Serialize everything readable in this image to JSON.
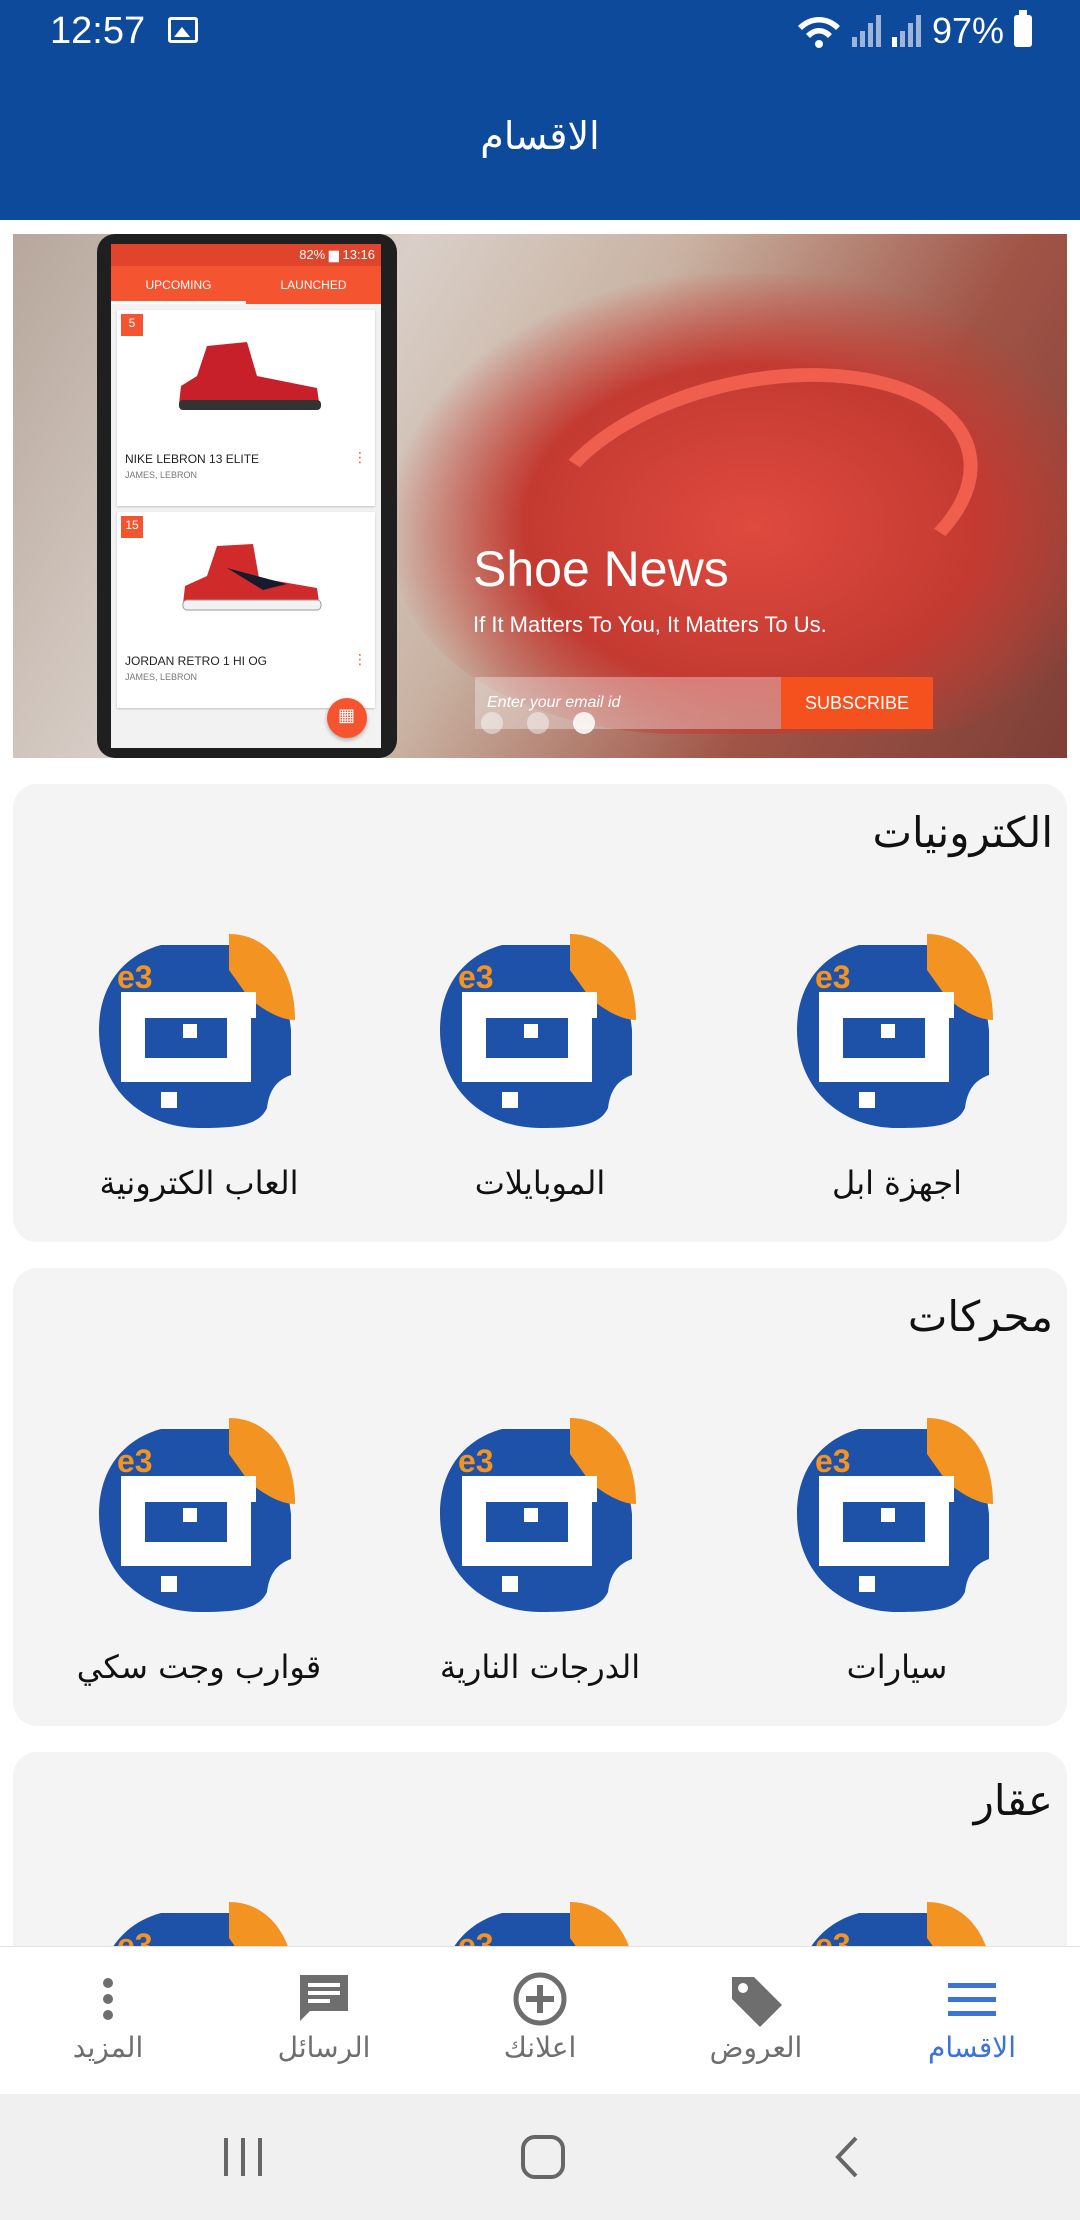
{
  "status_bar": {
    "time": "12:57",
    "battery": "97%"
  },
  "app_bar": {
    "title": "الاقسام"
  },
  "banner": {
    "title": "Shoe News",
    "subtitle": "If It Matters To You, It Matters To Us.",
    "email_placeholder": "Enter your email id",
    "subscribe_label": "SUBSCRIBE",
    "phone": {
      "status_time": "82% ▆ 13:16",
      "tab_upcoming": "UPCOMING",
      "tab_launched": "LAUNCHED",
      "card1_date": "5",
      "card1_name": "NIKE LEBRON 13 ELITE",
      "card1_sub": "JAMES, LEBRON",
      "card2_date": "15",
      "card2_name": "JORDAN RETRO 1 HI OG",
      "card2_sub": "JAMES, LEBRON"
    }
  },
  "sections": [
    {
      "title": "الكترونيات",
      "items": [
        "اجهزة ابل",
        "الموبايلات",
        "العاب الكترونية"
      ]
    },
    {
      "title": "محركات",
      "items": [
        "سيارات",
        "الدرجات النارية",
        "قوارب وجت سكي"
      ]
    },
    {
      "title": "عقار"
    }
  ],
  "logo_text": "e3",
  "bottom_nav": [
    {
      "label": "الاقسام",
      "icon": "menu-icon",
      "active": true
    },
    {
      "label": "العروض",
      "icon": "tag-icon",
      "active": false
    },
    {
      "label": "اعلانك",
      "icon": "add-circle-icon",
      "active": false
    },
    {
      "label": "الرسائل",
      "icon": "chat-icon",
      "active": false
    },
    {
      "label": "المزيد",
      "icon": "more-vertical-icon",
      "active": false
    }
  ],
  "colors": {
    "primary": "#0d4a9c",
    "accent_orange": "#f39321",
    "nav_active": "#3b73d6",
    "subscribe": "#f4511e"
  }
}
